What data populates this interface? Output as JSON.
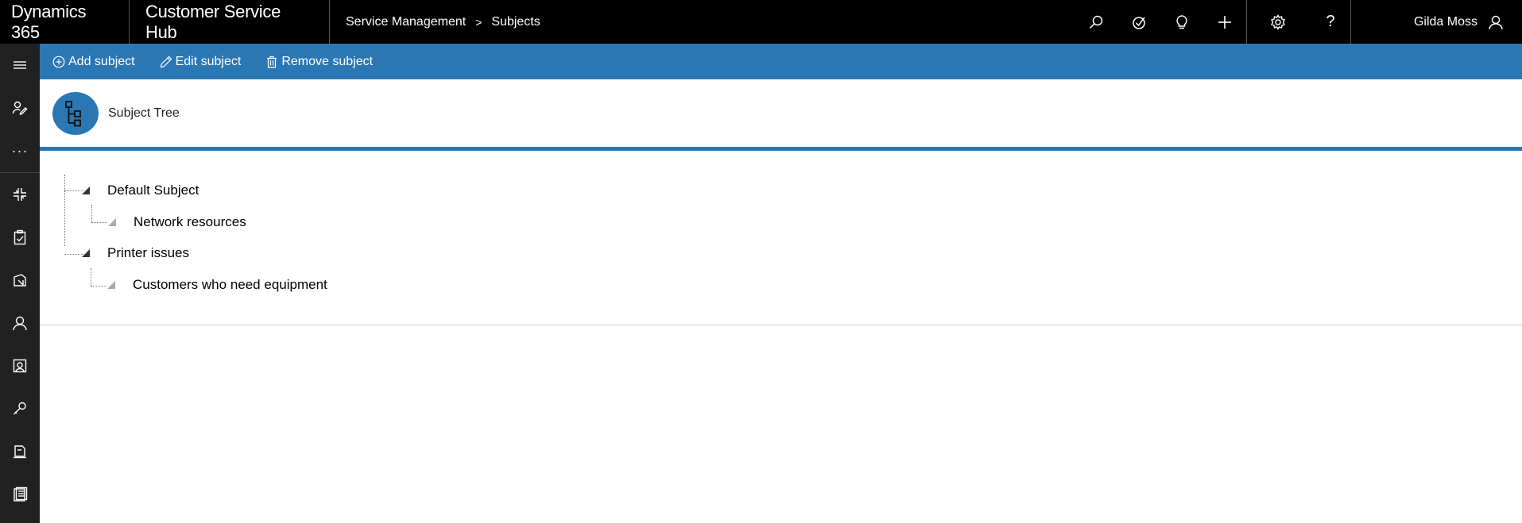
{
  "topbar": {
    "brand": "Dynamics 365",
    "app_name": "Customer Service Hub",
    "breadcrumb": {
      "area": "Service Management",
      "separator": ">",
      "page": "Subjects"
    },
    "icons": [
      "search-icon",
      "task-icon",
      "lightbulb-icon",
      "plus-icon",
      "settings-icon",
      "help-icon"
    ],
    "help_glyph": "?",
    "user_name": "Gilda Moss"
  },
  "leftrail": {
    "items": [
      "hamburger-icon",
      "pinned-icon",
      "more-icon",
      "dashboard-icon",
      "activities-icon",
      "accounts-icon",
      "contacts-icon",
      "social-profiles-icon",
      "tools-icon",
      "knowledge-icon",
      "reports-icon"
    ],
    "more_glyph": "···"
  },
  "cmdbar": {
    "add_label": "Add subject",
    "edit_label": "Edit subject",
    "remove_label": "Remove subject"
  },
  "header": {
    "title": "Subject Tree"
  },
  "tree": {
    "nodes": [
      {
        "label": "Default Subject"
      },
      {
        "label": "Network resources"
      },
      {
        "label": "Printer issues"
      },
      {
        "label": "Customers who need equipment"
      }
    ]
  },
  "colors": {
    "topbar": "#000000",
    "accent": "#2b77b4",
    "leftrail": "#212121"
  }
}
